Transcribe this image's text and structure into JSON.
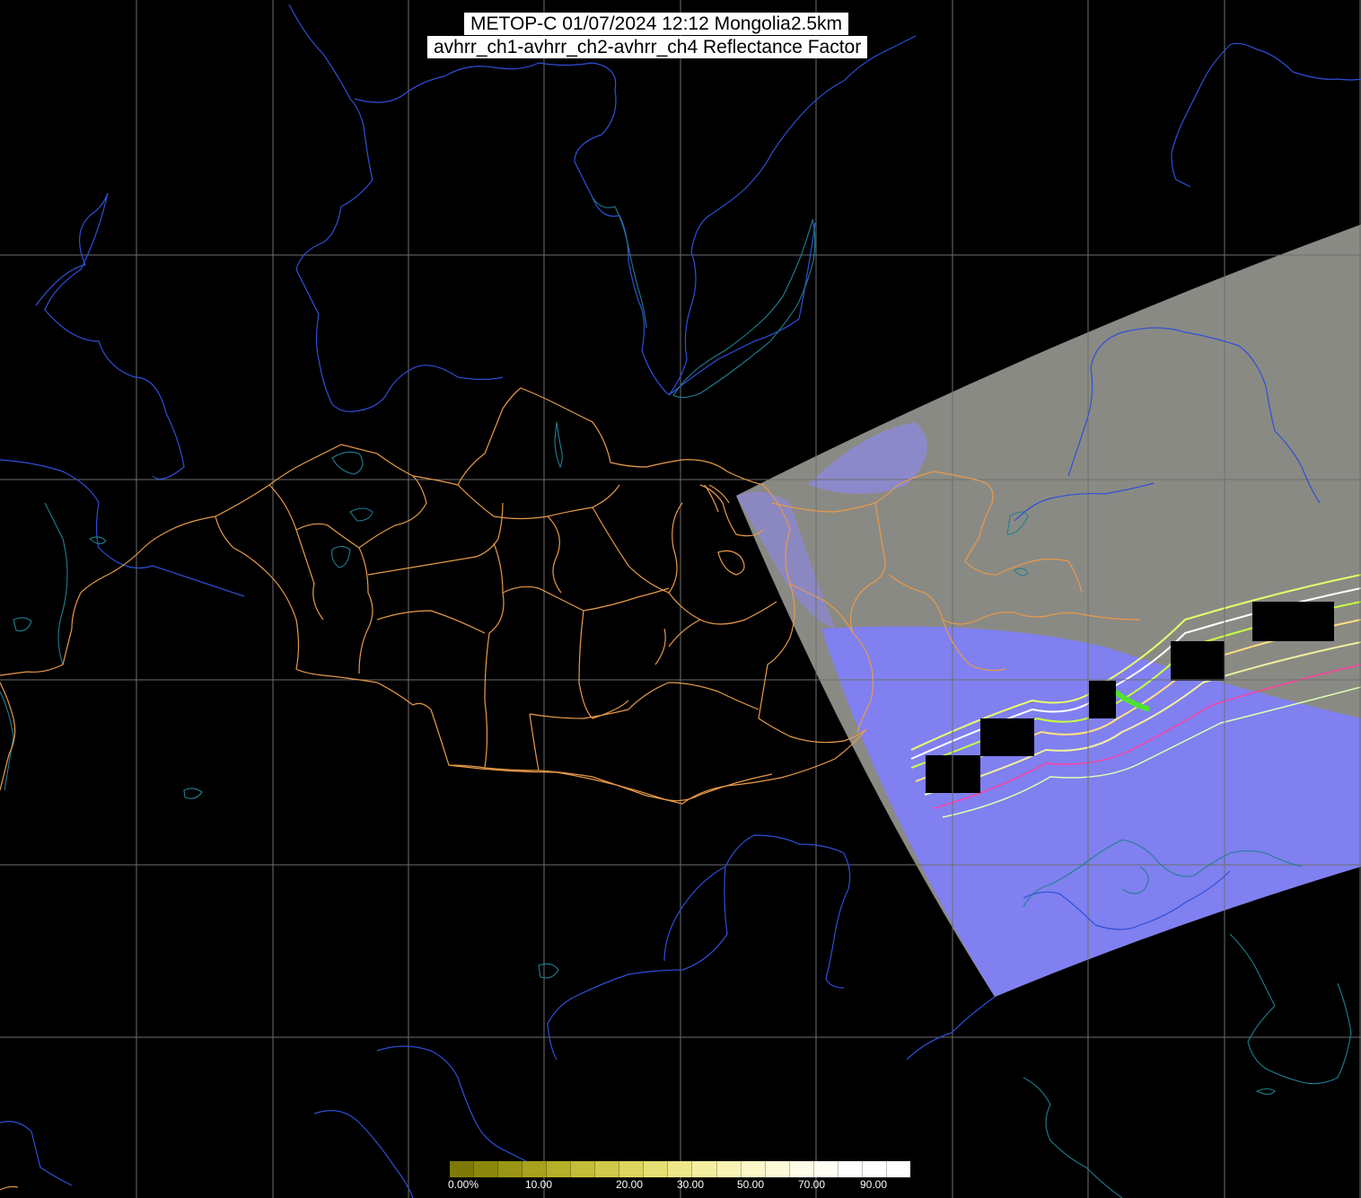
{
  "title": {
    "line1": "METOP-C 01/07/2024 12:12 Mongolia2.5km",
    "line2": "avhrr_ch1-avhrr_ch2-avhrr_ch4 Reflectance Factor"
  },
  "colors": {
    "background": "#000000",
    "grid": "#6e6e6e",
    "country_borders": "#2f4fd8",
    "coastlines": "#1f7f8f",
    "province_borders": "#e89a4a",
    "swath": "#8a8a84",
    "cloud": "#8080f0",
    "data_gap": "#000000"
  },
  "colorbar": {
    "labels": [
      "0.00%",
      "10.00",
      "20.00",
      "30.00",
      "50.00",
      "70.00",
      "90.00"
    ],
    "colors": [
      "#7e7a08",
      "#8c880e",
      "#9a9514",
      "#a8a21c",
      "#b6af28",
      "#c4bd38",
      "#d0c94a",
      "#dcd55e",
      "#e6df74",
      "#eee88a",
      "#f4eea0",
      "#f8f3b4",
      "#fbf7c8",
      "#fdfad8",
      "#fefce6",
      "#fffef2",
      "#ffffff",
      "#ffffff",
      "#ffffff"
    ]
  }
}
